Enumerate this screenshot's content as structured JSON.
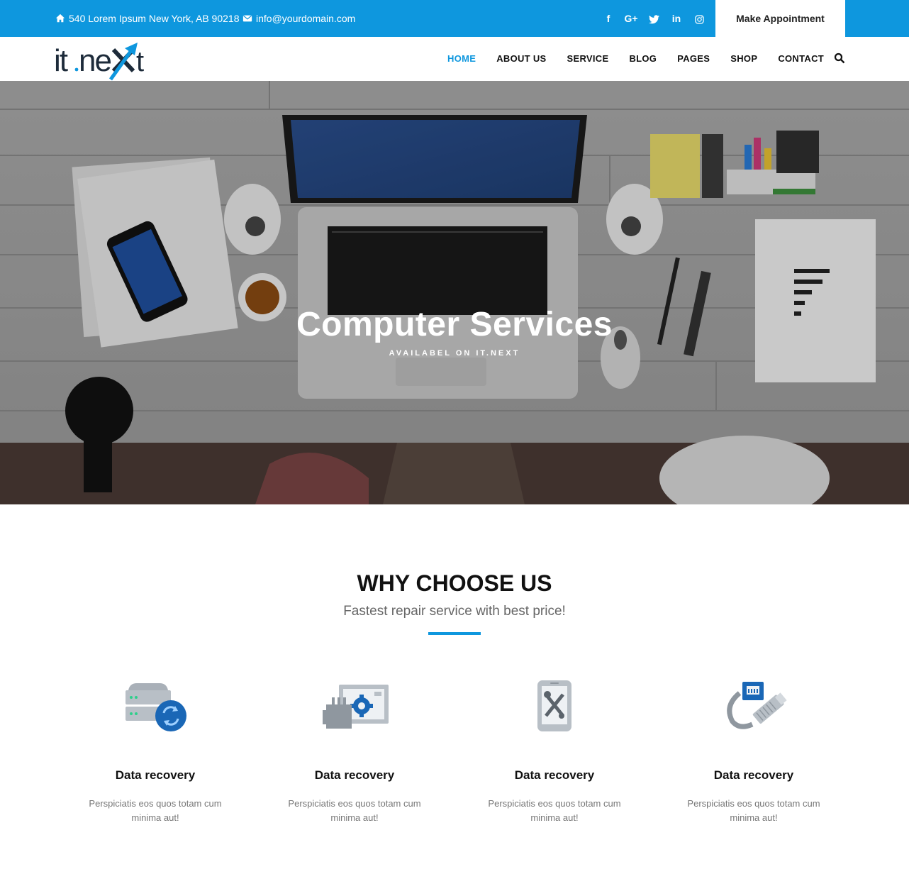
{
  "topbar": {
    "address": "540 Lorem Ipsum New York, AB 90218",
    "email": "info@yourdomain.com",
    "social": [
      {
        "icon": "facebook-icon",
        "label": "f"
      },
      {
        "icon": "google-plus-icon",
        "label": "G+"
      },
      {
        "icon": "twitter-icon",
        "label": "t"
      },
      {
        "icon": "linkedin-icon",
        "label": "in"
      },
      {
        "icon": "instagram-icon",
        "label": "◎"
      }
    ],
    "appointment_label": "Make Appointment"
  },
  "brand": {
    "logo_text": "it.next",
    "accent": "#0e97de",
    "dark": "#1d2b3a"
  },
  "nav": {
    "items": [
      {
        "label": "HOME",
        "active": true
      },
      {
        "label": "ABOUT US",
        "active": false
      },
      {
        "label": "SERVICE",
        "active": false
      },
      {
        "label": "BLOG",
        "active": false
      },
      {
        "label": "PAGES",
        "active": false
      },
      {
        "label": "SHOP",
        "active": false
      },
      {
        "label": "CONTACT",
        "active": false
      }
    ],
    "search_icon": "search-icon"
  },
  "hero": {
    "title": "Computer Services",
    "subtitle": "AVAILABEL ON IT.NEXT"
  },
  "why": {
    "title": "WHY CHOOSE US",
    "subtitle": "Fastest repair service with best price!",
    "features": [
      {
        "icon": "server-sync-icon",
        "title": "Data recovery",
        "desc": "Perspiciatis eos quos totam cum minima aut!"
      },
      {
        "icon": "hardware-settings-icon",
        "title": "Data recovery",
        "desc": "Perspiciatis eos quos totam cum minima aut!"
      },
      {
        "icon": "mobile-repair-icon",
        "title": "Data recovery",
        "desc": "Perspiciatis eos quos totam cum minima aut!"
      },
      {
        "icon": "network-cable-icon",
        "title": "Data recovery",
        "desc": "Perspiciatis eos quos totam cum minima aut!"
      }
    ]
  }
}
